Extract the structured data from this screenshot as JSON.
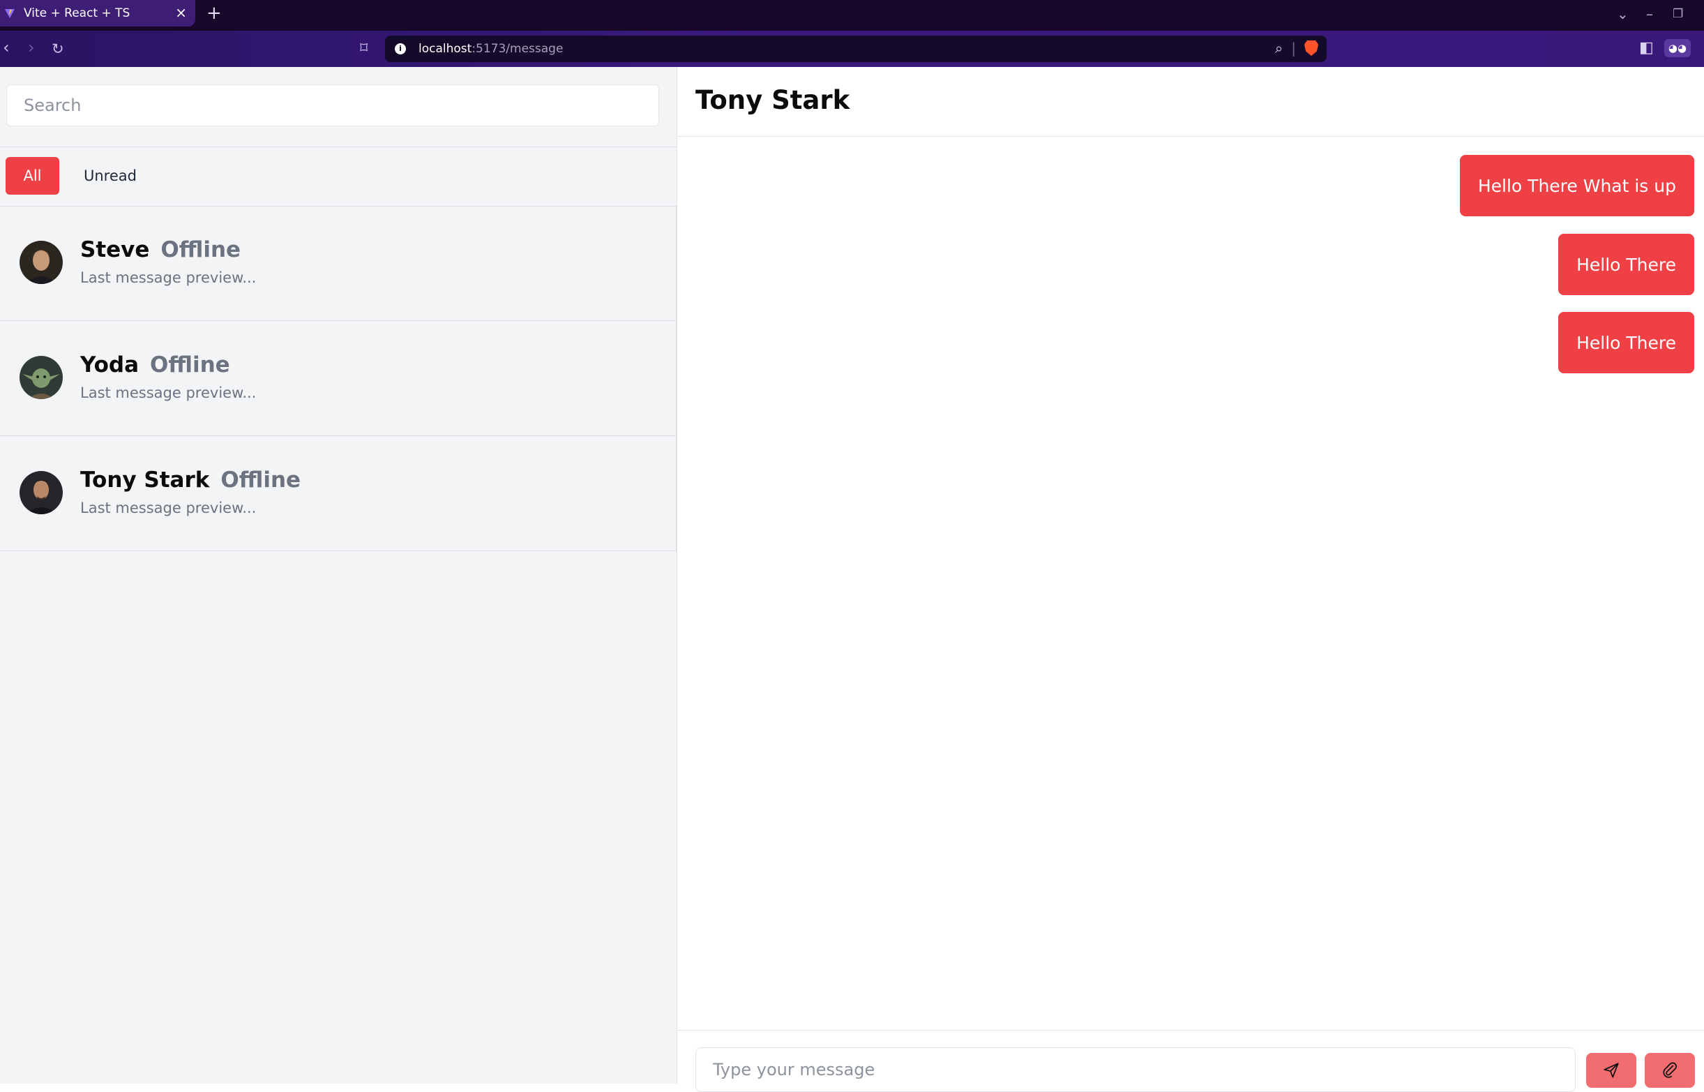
{
  "browser": {
    "tab_title": "Vite + React + TS",
    "tab_close": "×",
    "new_tab": "+",
    "url_host": "localhost",
    "url_path": ":5173/message"
  },
  "sidebar": {
    "search_placeholder": "Search",
    "filters": [
      {
        "label": "All",
        "active": true
      },
      {
        "label": "Unread",
        "active": false
      }
    ],
    "conversations": [
      {
        "name": "Steve",
        "status": "Offline",
        "preview": "Last message preview..."
      },
      {
        "name": "Yoda",
        "status": "Offline",
        "preview": "Last message preview..."
      },
      {
        "name": "Tony Stark",
        "status": "Offline",
        "preview": "Last message preview..."
      }
    ]
  },
  "chat": {
    "title": "Tony Stark",
    "messages": [
      {
        "text": "Hello There What is up",
        "from": "me"
      },
      {
        "text": "Hello There",
        "from": "me"
      },
      {
        "text": "Hello There",
        "from": "me"
      }
    ],
    "input_placeholder": "Type your message"
  },
  "colors": {
    "accent": "#ef4145",
    "send_button": "#f26d70",
    "sidebar_bg": "#f3f4f6",
    "browser_toolbar": "#2a1362"
  }
}
